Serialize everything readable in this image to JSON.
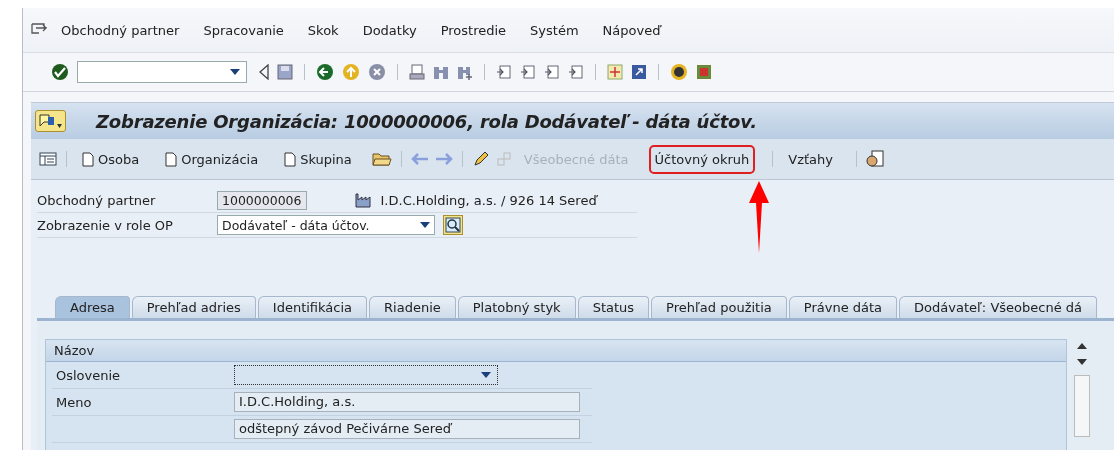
{
  "menu_bar": {
    "items": [
      "Obchodný partner",
      "Spracovanie",
      "Skok",
      "Dodatky",
      "Prostredie",
      "Systém",
      "Nápoveď"
    ]
  },
  "window": {
    "title": "Zobrazenie Organizácia: 1000000006, rola Dodávateľ - dáta účtov."
  },
  "app_toolbar": {
    "buttons": [
      {
        "label": "Osoba",
        "kind": "doc",
        "disabled": false,
        "highlighted": false
      },
      {
        "label": "Organizácia",
        "kind": "doc",
        "disabled": false,
        "highlighted": false
      },
      {
        "label": "Skupina",
        "kind": "doc",
        "disabled": false,
        "highlighted": false
      },
      {
        "label": "Všeobecné dáta",
        "kind": "text",
        "disabled": true,
        "highlighted": false
      },
      {
        "label": "Účtovný okruh",
        "kind": "text",
        "disabled": false,
        "highlighted": true
      },
      {
        "label": "Vzťahy",
        "kind": "text",
        "disabled": false,
        "highlighted": false
      }
    ]
  },
  "header": {
    "partner_label": "Obchodný partner",
    "partner_value": "1000000006",
    "partner_desc": "I.D.C.Holding, a.s. / 926 14 Sereď",
    "role_label": "Zobrazenie v role OP",
    "role_value": "Dodávateľ - dáta účtov."
  },
  "tabs": [
    {
      "label": "Adresa",
      "selected": true
    },
    {
      "label": "Prehľad adries",
      "selected": false
    },
    {
      "label": "Identifikácia",
      "selected": false
    },
    {
      "label": "Riadenie",
      "selected": false
    },
    {
      "label": "Platobný styk",
      "selected": false
    },
    {
      "label": "Status",
      "selected": false
    },
    {
      "label": "Prehľad použitia",
      "selected": false
    },
    {
      "label": "Právne dáta",
      "selected": false
    },
    {
      "label": "Dodávateľ: Všeobecné dá",
      "selected": false
    }
  ],
  "section": {
    "title": "Názov",
    "rows": [
      {
        "label": "Oslovenie",
        "value": "",
        "kind": "dropdown"
      },
      {
        "label": "Meno",
        "value": "I.D.C.Holding, a.s.",
        "kind": "text"
      },
      {
        "label": "",
        "value": "odštepný závod Pečivárne Sereď",
        "kind": "text"
      }
    ]
  }
}
